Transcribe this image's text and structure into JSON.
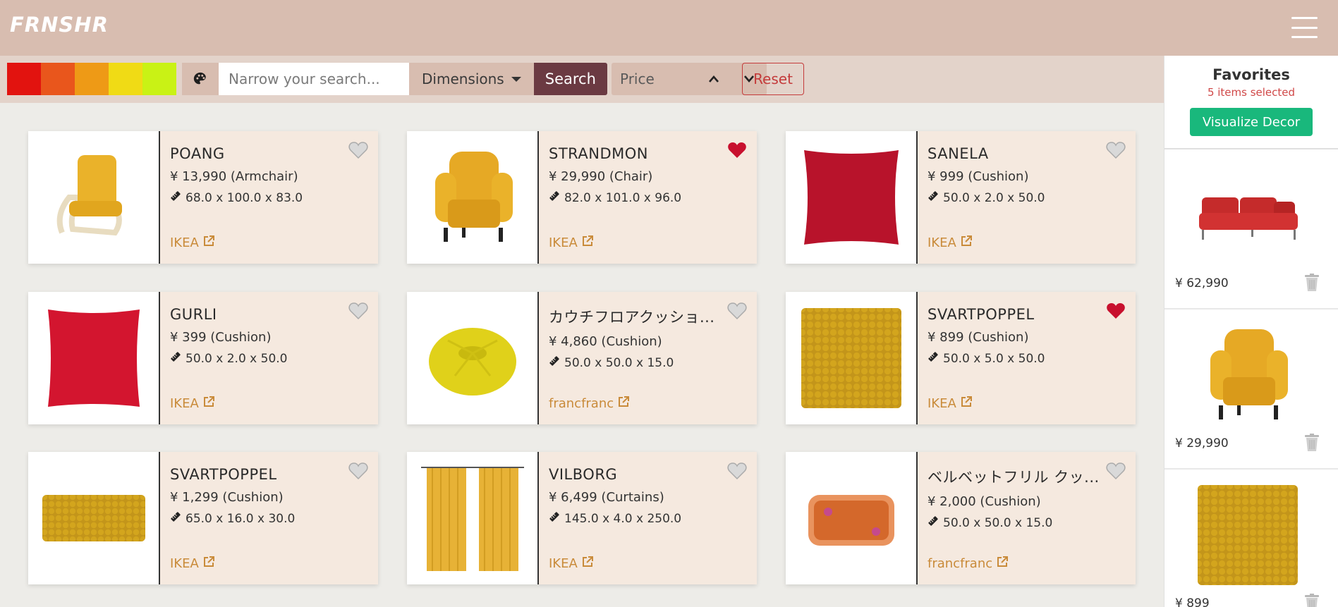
{
  "app": {
    "logo": "FRNSHR"
  },
  "colors": {
    "header_bg": "#d8bdb0",
    "accent_search": "#6b3a42",
    "favorite_heart": "#c8102e",
    "link": "#c98b3a",
    "visualize_button": "#19b87c"
  },
  "toolbar": {
    "swatches": [
      "#e2130f",
      "#e9561c",
      "#ee9a16",
      "#f0db15",
      "#c9f215"
    ],
    "palette_icon": "palette-icon",
    "search_placeholder": "Narrow your search...",
    "dimensions_label": "Dimensions",
    "search_label": "Search",
    "price_label": "Price",
    "reset_label": "Reset"
  },
  "products": [
    {
      "name": "POANG",
      "price": "¥ 13,990 (Armchair)",
      "dims": "68.0 x 100.0 x 83.0",
      "store": "IKEA",
      "favorited": false
    },
    {
      "name": "STRANDMON",
      "price": "¥ 29,990 (Chair)",
      "dims": "82.0 x 101.0 x 96.0",
      "store": "IKEA",
      "favorited": true
    },
    {
      "name": "SANELA",
      "price": "¥ 999 (Cushion)",
      "dims": "50.0 x 2.0 x 50.0",
      "store": "IKEA",
      "favorited": false
    },
    {
      "name": "GURLI",
      "price": "¥ 399 (Cushion)",
      "dims": "50.0 x 2.0 x 50.0",
      "store": "IKEA",
      "favorited": false
    },
    {
      "name": "カウチフロアクッショ...",
      "price": "¥ 4,860 (Cushion)",
      "dims": "50.0 x 50.0 x 15.0",
      "store": "francfranc",
      "favorited": false
    },
    {
      "name": "SVARTPOPPEL",
      "price": "¥ 899 (Cushion)",
      "dims": "50.0 x 5.0 x 50.0",
      "store": "IKEA",
      "favorited": true
    },
    {
      "name": "SVARTPOPPEL",
      "price": "¥ 1,299 (Cushion)",
      "dims": "65.0 x 16.0 x 30.0",
      "store": "IKEA",
      "favorited": false
    },
    {
      "name": "VILBORG",
      "price": "¥ 6,499 (Curtains)",
      "dims": "145.0 x 4.0 x 250.0",
      "store": "IKEA",
      "favorited": false
    },
    {
      "name": "ベルベットフリル クッ...",
      "price": "¥ 2,000 (Cushion)",
      "dims": "50.0 x 50.0 x 15.0",
      "store": "francfranc",
      "favorited": false
    }
  ],
  "favorites": {
    "title": "Favorites",
    "count_text": "5 items selected",
    "visualize_label": "Visualize Decor",
    "items": [
      {
        "price": "¥ 62,990"
      },
      {
        "price": "¥ 29,990"
      },
      {
        "price": "¥ 899"
      }
    ]
  }
}
